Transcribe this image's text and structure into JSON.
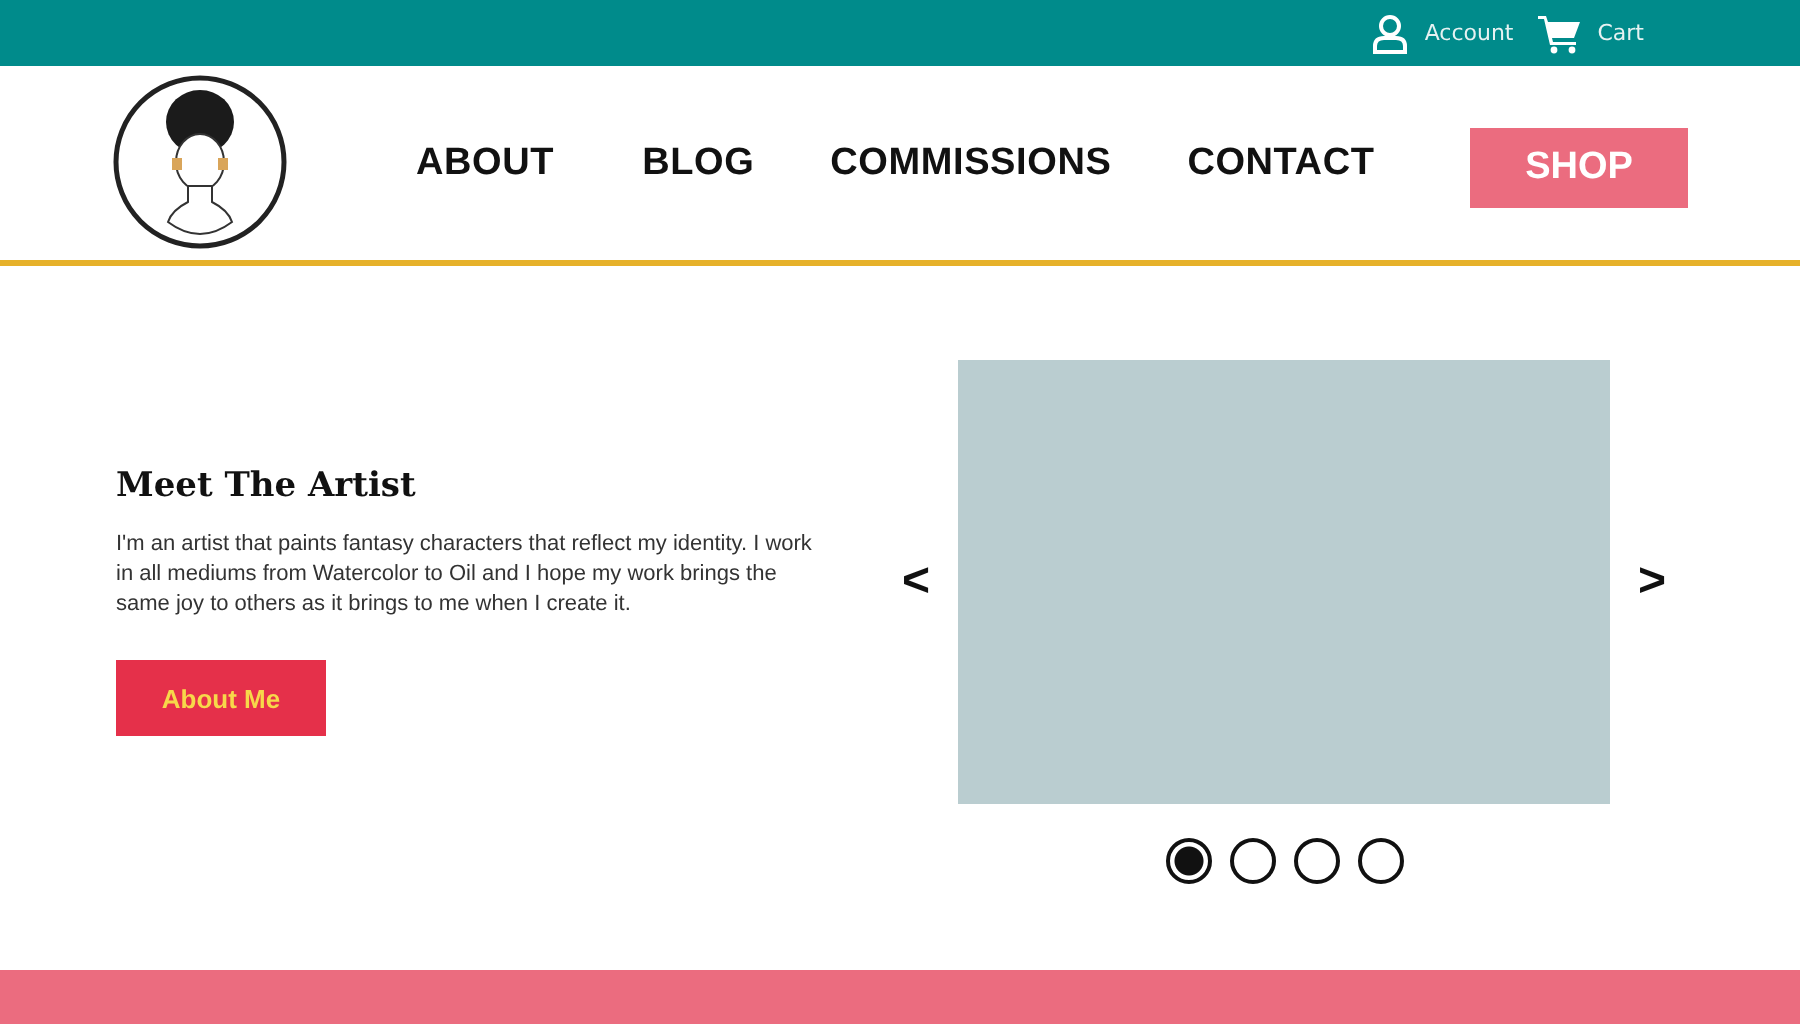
{
  "top_bar": {
    "links": [
      {
        "kind": "account",
        "label": "Account"
      },
      {
        "kind": "cart",
        "label": "Cart"
      }
    ]
  },
  "nav": {
    "items": [
      "ABOUT",
      "BLOG",
      "COMMISSIONS",
      "CONTACT"
    ],
    "shop_button": "SHOP"
  },
  "intro": {
    "title": "Meet The Artist",
    "text": "I'm an artist that paints fantasy characters that reflect my identity. I work in all mediums from Watercolor to Oil and I hope my work brings the same joy to others as it brings to me when I create it.",
    "button": "About Me"
  },
  "carousel": {
    "prev": "<",
    "next": ">",
    "dots": [
      {
        "selected": true
      },
      {
        "selected": false
      },
      {
        "selected": false
      },
      {
        "selected": false
      }
    ]
  }
}
